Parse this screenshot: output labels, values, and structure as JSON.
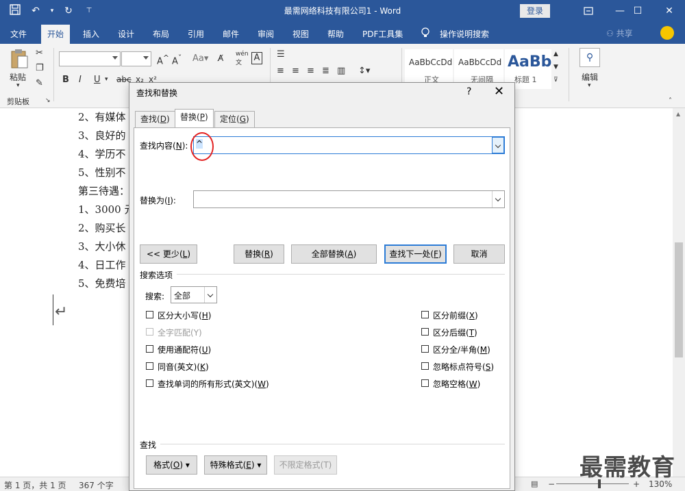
{
  "window": {
    "title": "最需网络科技有限公司1 - Word",
    "login": "登录"
  },
  "ribbon_tabs": [
    "文件",
    "开始",
    "插入",
    "设计",
    "布局",
    "引用",
    "邮件",
    "审阅",
    "视图",
    "帮助",
    "PDF工具集",
    "操作说明搜索"
  ],
  "active_tab": "开始",
  "share_label": "共享",
  "clipboard": {
    "paste_label": "粘贴",
    "group_label": "剪贴板"
  },
  "styles": [
    {
      "preview": "AaBbCcDd",
      "name": "正文"
    },
    {
      "preview": "AaBbCcDd",
      "name": "无间隔"
    },
    {
      "preview": "AaBb",
      "name": "标题 1"
    }
  ],
  "editing_label": "编辑",
  "document": {
    "lines": [
      "2、有媒体",
      "3、良好的",
      "4、学历不",
      "5、性别不",
      "第三待遇：",
      "1、3000 元",
      "2、购买长",
      "3、大小休",
      "4、日工作",
      "5、免费培"
    ]
  },
  "dialog": {
    "title": "查找和替换",
    "help": "?",
    "close": "✕",
    "tabs": [
      {
        "label": "查找",
        "key": "D"
      },
      {
        "label": "替换",
        "key": "P"
      },
      {
        "label": "定位",
        "key": "G"
      }
    ],
    "active_tab": "替换",
    "find_label": "查找内容",
    "find_key": "N",
    "find_value": "^",
    "replace_label": "替换为",
    "replace_key": "I",
    "replace_value": "",
    "buttons": {
      "less": "<< 更少",
      "less_key": "L",
      "replace": "替换",
      "replace_key": "R",
      "replace_all": "全部替换",
      "replace_all_key": "A",
      "find_next": "查找下一处",
      "find_next_key": "F",
      "cancel": "取消"
    },
    "search_options_title": "搜索选项",
    "search_label": "搜索",
    "search_value": "全部",
    "options_left": [
      {
        "label": "区分大小写",
        "key": "H",
        "checked": false,
        "disabled": false
      },
      {
        "label": "全字匹配",
        "key": "Y",
        "checked": false,
        "disabled": true
      },
      {
        "label": "使用通配符",
        "key": "U",
        "checked": false,
        "disabled": false
      },
      {
        "label": "同音(英文)",
        "key": "K",
        "checked": false,
        "disabled": false
      },
      {
        "label": "查找单词的所有形式(英文)",
        "key": "W",
        "checked": false,
        "disabled": false
      }
    ],
    "options_right": [
      {
        "label": "区分前缀",
        "key": "X",
        "checked": false
      },
      {
        "label": "区分后缀",
        "key": "T",
        "checked": false
      },
      {
        "label": "区分全/半角",
        "key": "M",
        "checked": false
      },
      {
        "label": "忽略标点符号",
        "key": "S",
        "checked": false
      },
      {
        "label": "忽略空格",
        "key": "W",
        "checked": false
      }
    ],
    "find_section_title": "查找",
    "bottom_buttons": {
      "format": "格式",
      "format_key": "O",
      "special": "特殊格式",
      "special_key": "E",
      "no_format": "不限定格式(T)"
    }
  },
  "status": {
    "page": "第 1 页，共 1 页",
    "words": "367 个字",
    "zoom": "130%"
  },
  "watermark": "最需教育",
  "colors": {
    "word_blue": "#2b579a",
    "focus_blue": "#2b7bd6",
    "annotation_red": "#e32222"
  }
}
